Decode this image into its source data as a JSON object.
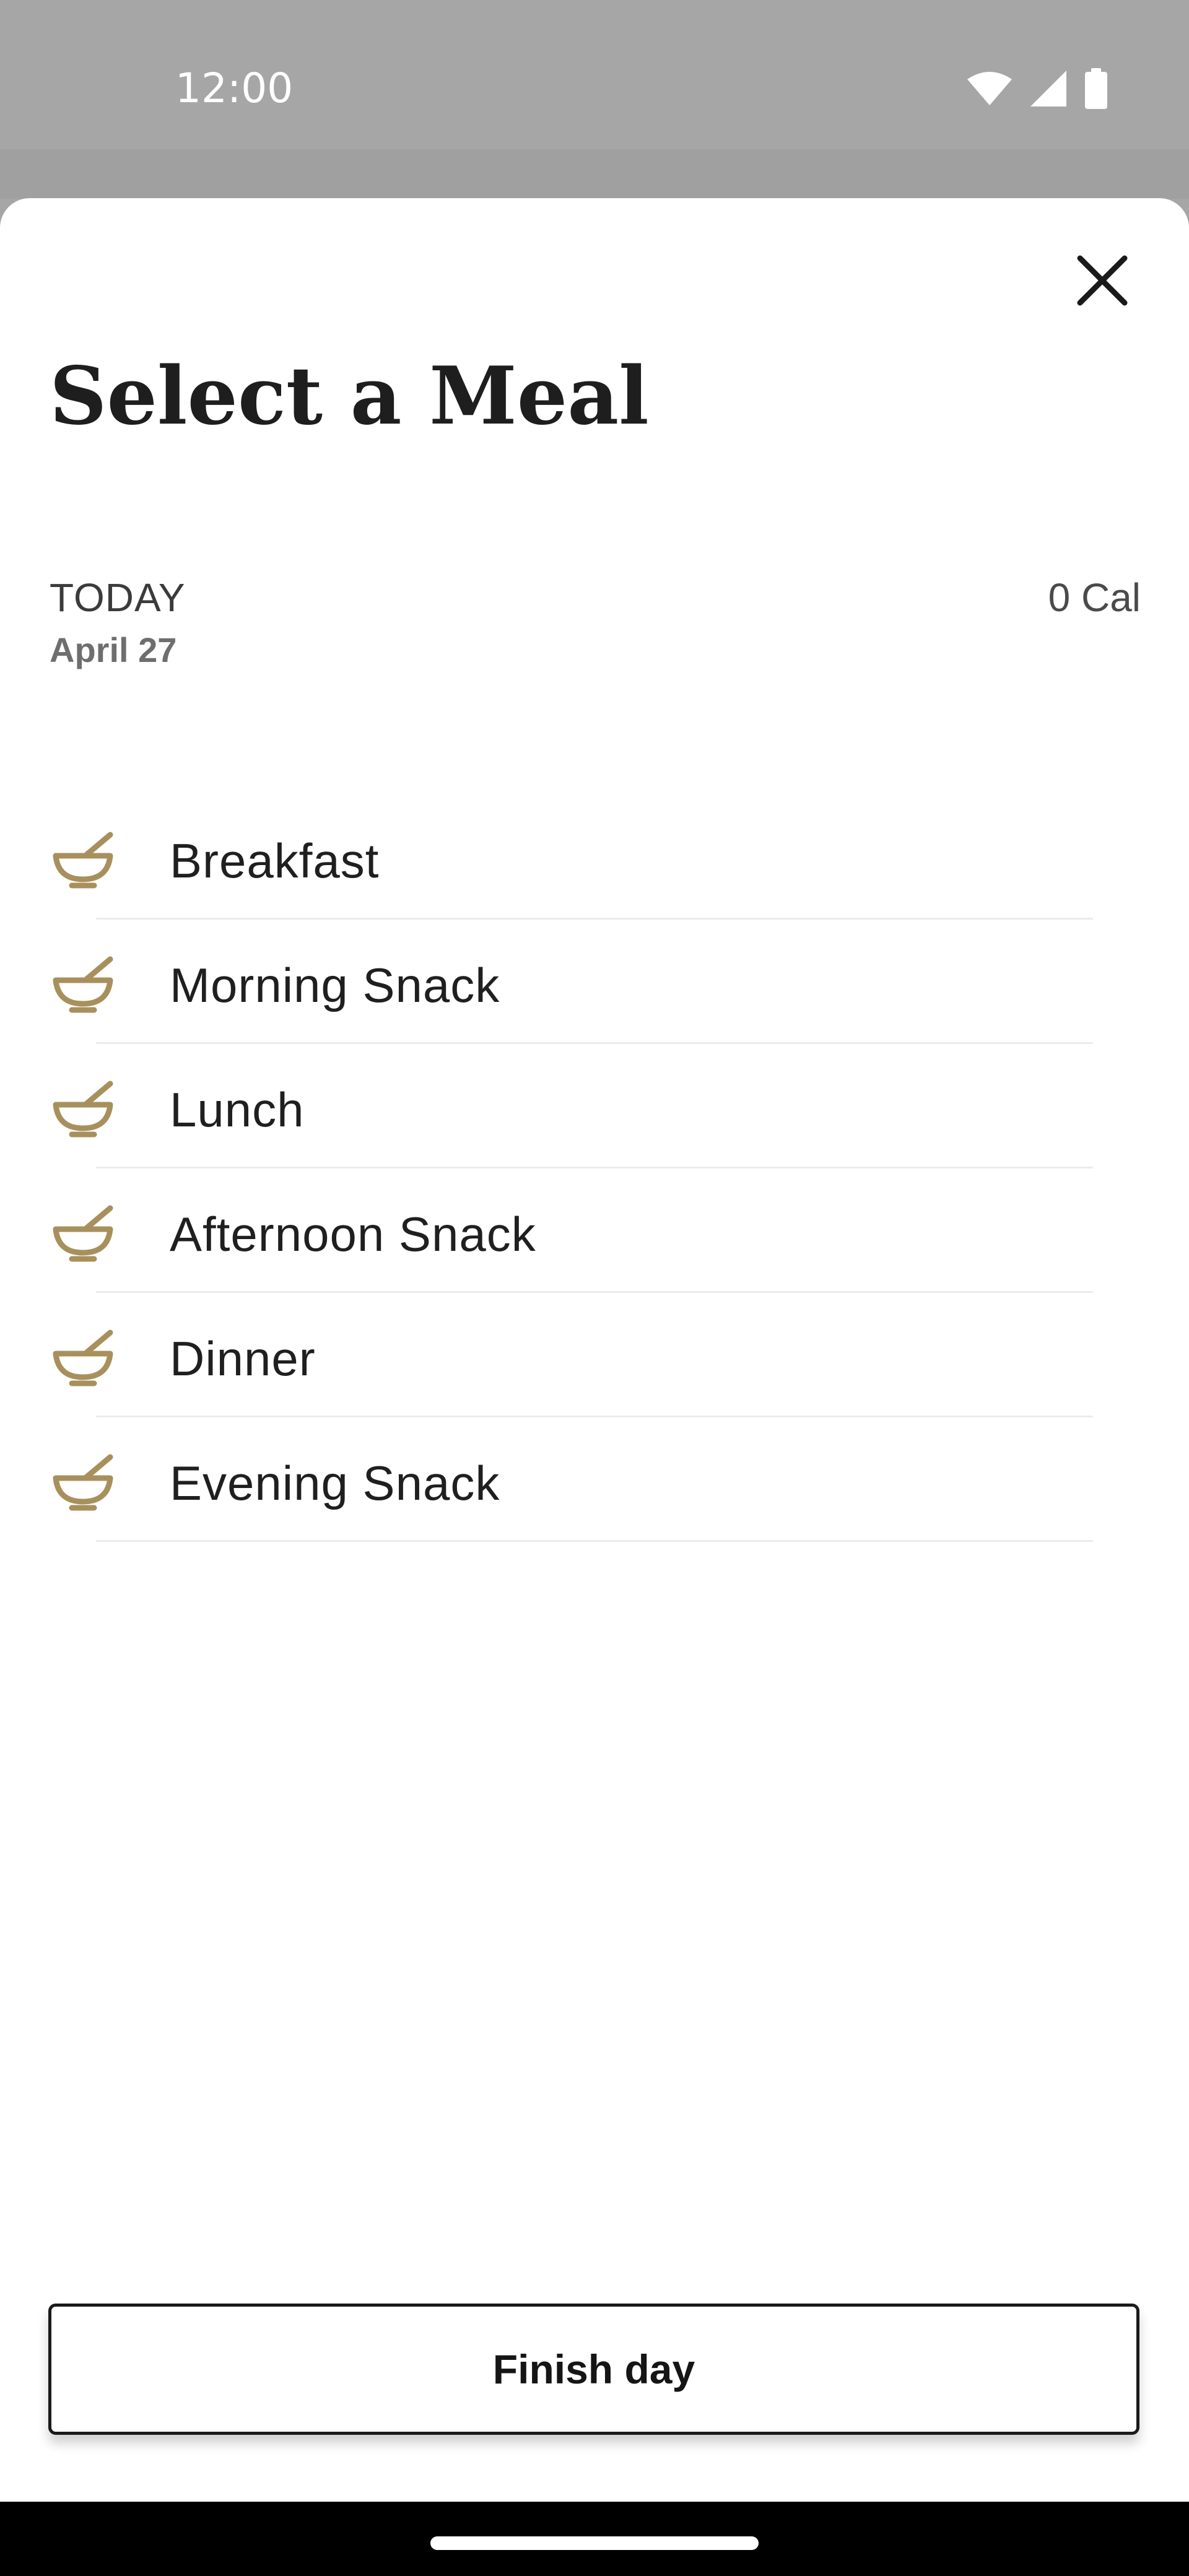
{
  "status_bar": {
    "time": "12:00",
    "icons": [
      "wifi-icon",
      "cellular-signal-icon",
      "battery-icon"
    ]
  },
  "sheet": {
    "title": "Select a Meal",
    "close_icon": "close-icon"
  },
  "day": {
    "label": "TODAY",
    "date": "April 27",
    "calories": "0 Cal"
  },
  "meals": [
    {
      "label": "Breakfast",
      "icon": "bowl-icon"
    },
    {
      "label": "Morning Snack",
      "icon": "bowl-icon"
    },
    {
      "label": "Lunch",
      "icon": "bowl-icon"
    },
    {
      "label": "Afternoon Snack",
      "icon": "bowl-icon"
    },
    {
      "label": "Dinner",
      "icon": "bowl-icon"
    },
    {
      "label": "Evening Snack",
      "icon": "bowl-icon"
    }
  ],
  "footer": {
    "finish_label": "Finish day"
  },
  "colors": {
    "accent_gold": "#a8905d",
    "text_dark": "#1e1e1e",
    "scrim_gray": "#a6a6a6"
  }
}
